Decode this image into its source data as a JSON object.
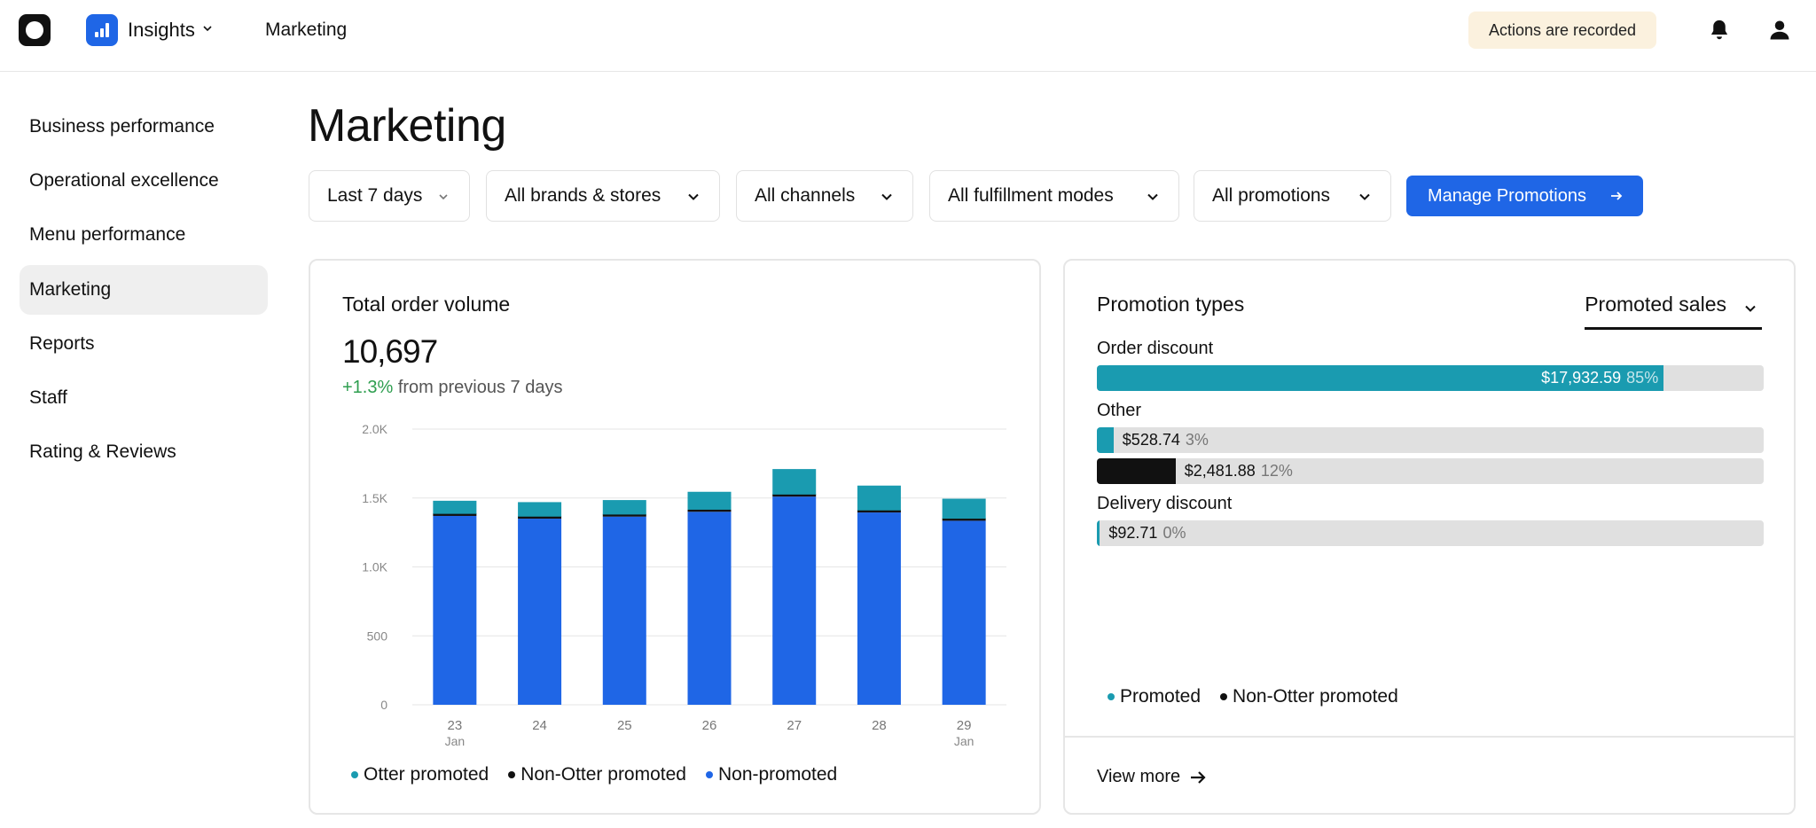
{
  "topbar": {
    "app_name": "Insights",
    "section": "Marketing",
    "recorded_badge": "Actions are recorded",
    "icons": [
      "logo-icon",
      "insights-chart-icon",
      "chevron-down-icon",
      "bell-icon",
      "user-icon"
    ]
  },
  "sidebar": {
    "items": [
      {
        "label": "Business performance",
        "active": false
      },
      {
        "label": "Operational excellence",
        "active": false
      },
      {
        "label": "Menu performance",
        "active": false
      },
      {
        "label": "Marketing",
        "active": true
      },
      {
        "label": "Reports",
        "active": false
      },
      {
        "label": "Staff",
        "active": false
      },
      {
        "label": "Rating & Reviews",
        "active": false
      }
    ]
  },
  "page": {
    "title": "Marketing"
  },
  "filters": {
    "date": "Last 7 days",
    "brands": "All brands & stores",
    "channels": "All channels",
    "fulfillment": "All fulfillment modes",
    "promotions": "All promotions",
    "manage_button": "Manage Promotions"
  },
  "order_volume": {
    "title": "Total order volume",
    "total": "10,697",
    "delta": "+1.3%",
    "delta_suffix": "from previous 7 days",
    "legend": [
      "Otter promoted",
      "Non-Otter promoted",
      "Non-promoted"
    ]
  },
  "chart_data": {
    "type": "bar",
    "stacked": true,
    "categories": [
      "23",
      "24",
      "25",
      "26",
      "27",
      "28",
      "29"
    ],
    "category_sublabels": [
      "Jan",
      "",
      "",
      "",
      "",
      "",
      "Jan"
    ],
    "series": [
      {
        "name": "Non-promoted",
        "values": [
          1370,
          1350,
          1365,
          1400,
          1510,
          1395,
          1335
        ]
      },
      {
        "name": "Non-Otter promoted",
        "values": [
          15,
          15,
          15,
          15,
          15,
          15,
          15
        ]
      },
      {
        "name": "Otter promoted",
        "values": [
          95,
          105,
          105,
          130,
          185,
          180,
          145
        ]
      }
    ],
    "ylim": [
      0,
      2000
    ],
    "yticks": [
      "0",
      "500",
      "1.0K",
      "1.5K",
      "2.0K"
    ],
    "grid": true,
    "legend_position": "bottom",
    "colors": {
      "Otter promoted": "#1a9bb0",
      "Non-Otter promoted": "#111111",
      "Non-promoted": "#1f66e6"
    }
  },
  "promotion_types": {
    "title": "Promotion types",
    "metric_select": "Promoted sales",
    "groups": [
      {
        "label": "Order discount",
        "bars": [
          {
            "kind": "Promoted",
            "amount": "$17,932.59",
            "pct": "85%",
            "fraction": 0.85
          }
        ]
      },
      {
        "label": "Other",
        "bars": [
          {
            "kind": "Promoted",
            "amount": "$528.74",
            "pct": "3%",
            "fraction": 0.025
          },
          {
            "kind": "Non-Otter promoted",
            "amount": "$2,481.88",
            "pct": "12%",
            "fraction": 0.118
          }
        ]
      },
      {
        "label": "Delivery discount",
        "bars": [
          {
            "kind": "Promoted",
            "amount": "$92.71",
            "pct": "0%",
            "fraction": 0.004
          }
        ]
      }
    ],
    "legend": [
      "Promoted",
      "Non-Otter promoted"
    ],
    "view_more": "View more",
    "colors": {
      "Promoted": "#1a9bb0",
      "Non-Otter promoted": "#111111",
      "track": "#e0e0e0"
    }
  }
}
